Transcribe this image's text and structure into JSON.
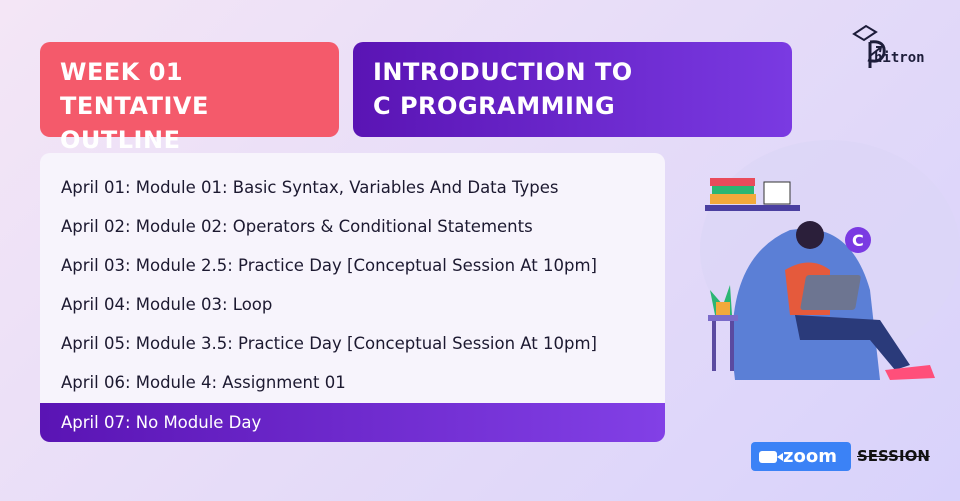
{
  "header": {
    "week_line1": "WEEK 01",
    "week_line2": "TENTATIVE OUTLINE",
    "topic_line1": "INTRODUCTION TO",
    "topic_line2": "C PROGRAMMING"
  },
  "brand": {
    "logo_text": "hitron"
  },
  "schedule": [
    "April 01: Module 01: Basic Syntax, Variables And Data Types",
    "April 02: Module 02: Operators & Conditional Statements",
    "April 03: Module 2.5: Practice Day [Conceptual Session At 10pm]",
    "April 04: Module 03: Loop",
    "April 05: Module 3.5: Practice Day [Conceptual Session At 10pm]",
    "April 06: Module 4: Assignment 01",
    "April 07: No Module Day"
  ],
  "footer": {
    "zoom_label": "zoom",
    "session_label": "SESSION"
  },
  "colors": {
    "coral": "#f45a6b",
    "purple": "#5a14b4",
    "zoom_blue": "#3b82f6"
  }
}
